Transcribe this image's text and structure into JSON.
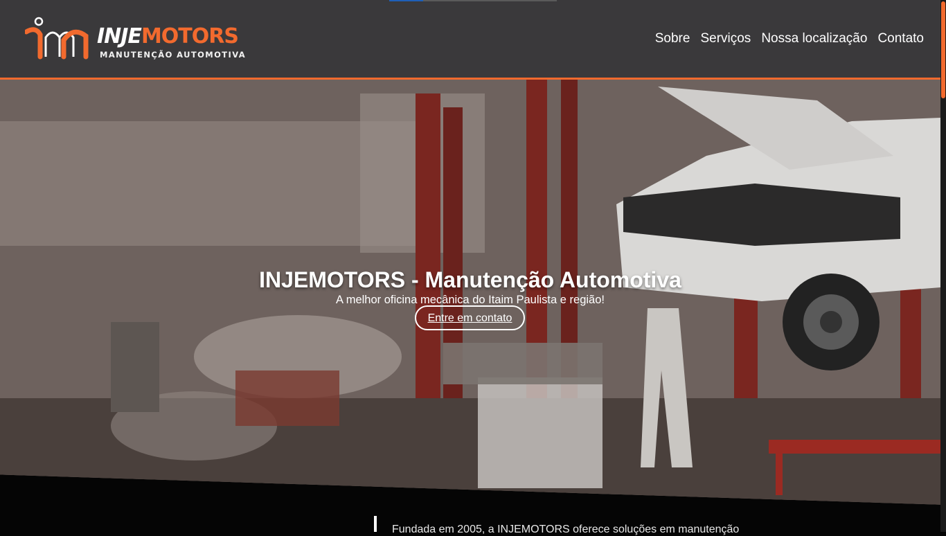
{
  "brand": {
    "name_part1": "INJE",
    "name_part2": "MOTORS",
    "tagline": "MANUTENÇÃO AUTOMOTIVA",
    "logo_icon": "im-monogram-logo"
  },
  "nav": {
    "items": [
      {
        "label": "Sobre"
      },
      {
        "label": "Serviços"
      },
      {
        "label": "Nossa localização"
      },
      {
        "label": "Contato"
      }
    ]
  },
  "hero": {
    "title": "INJEMOTORS - Manutenção Automotiva",
    "subtitle": "A melhor oficina mecânica do Itaim Paulista e região!",
    "cta_label": "Entre em contato",
    "background": "auto-repair-workshop-photo"
  },
  "about": {
    "teaser": "Fundada em 2005, a INJEMOTORS oferece soluções em manutenção"
  },
  "colors": {
    "accent": "#f26a2e",
    "header_bg": "#3a393b",
    "page_bg": "#050505"
  }
}
